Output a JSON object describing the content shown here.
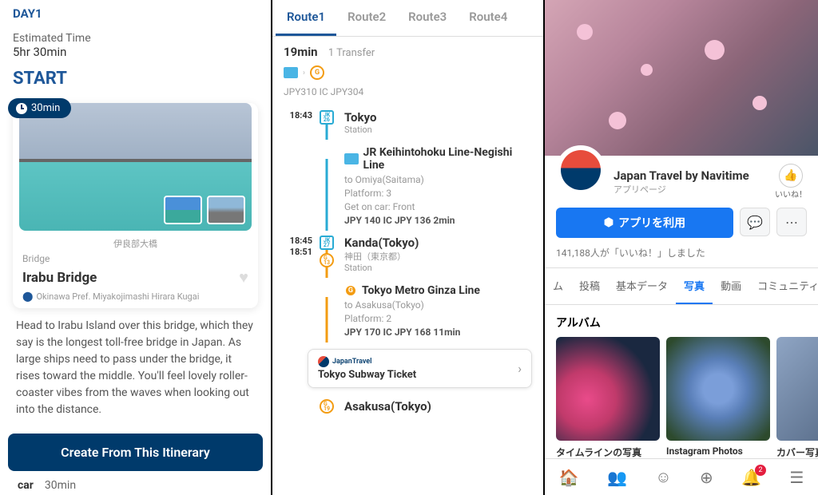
{
  "panel1": {
    "day": "DAY1",
    "estimatedLabel": "Estimated Time",
    "estimatedTime": "5hr 30min",
    "start": "START",
    "badge": "30min",
    "imageCaption": "伊良部大橋",
    "category": "Bridge",
    "poiName": "Irabu Bridge",
    "location": "Okinawa Pref. Miyakojimashi Hirara Kugai",
    "description": "Head to Irabu Island over this bridge, which they say is the longest toll-free bridge in Japan. As large ships need to pass under the bridge, it rises toward the middle. You'll feel lovely roller-coaster vibes from the waves when looking out into the distance.",
    "cta": "Create From This Itinerary",
    "nextMode": "car",
    "nextDuration": "30min"
  },
  "panel2": {
    "tabs": [
      "Route1",
      "Route2",
      "Route3",
      "Route4"
    ],
    "activeTab": 0,
    "duration": "19min",
    "transfers": "1 Transfer",
    "fare": "JPY310 IC JPY304",
    "steps": [
      {
        "time": "18:43",
        "marker": "JK\n26",
        "markerClass": "m-jk",
        "lineClass": "vl-blue",
        "name": "Tokyo",
        "sub": "Station"
      },
      {
        "time": "",
        "marker": "",
        "lineClass": "vl-blue",
        "lineName": "JR Keihintohoku Line-Negishi Line",
        "to": "to Omiya(Saitama)",
        "platform": "Platform: 3",
        "car": "Get on car: Front",
        "segFare": "JPY 140 IC JPY 136 2min",
        "lineIconClass": "ico-bus"
      },
      {
        "time": "18:45\n18:51",
        "marker": "JK\n27",
        "markerClass": "m-jk",
        "marker2": "G\n13",
        "marker2Class": "m-g",
        "lineClass": "vl-orange",
        "name": "Kanda(Tokyo)",
        "sub": "神田（東京都）",
        "sub2": "Station"
      },
      {
        "time": "",
        "marker": "",
        "lineClass": "vl-orange",
        "lineName": "Tokyo Metro Ginza Line",
        "to": "to Asakusa(Tokyo)",
        "platform": "Platform: 2",
        "segFare": "JPY 170 IC JPY 168 11min",
        "lineIconClass": "m-gf"
      },
      {
        "ticket": true,
        "logo": "JapanTravel",
        "title": "Tokyo Subway Ticket"
      },
      {
        "time": "",
        "marker": "G\n19",
        "markerClass": "m-g",
        "name": "Asakusa(Tokyo)"
      }
    ]
  },
  "panel3": {
    "pageTitle": "Japan Travel by Navitime",
    "pageSub": "アプリページ",
    "likeLabel": "いいね！",
    "useApp": "アプリを利用",
    "likesText": "141,188人が「いいね！」しました",
    "tabs": [
      "ム",
      "投稿",
      "基本データ",
      "写真",
      "動画",
      "コミュニティ"
    ],
    "activeTab": 3,
    "albumTitle": "アルバム",
    "albums": [
      {
        "cap": "タイムラインの写真",
        "cls": "a1"
      },
      {
        "cap": "Instagram Photos",
        "cls": "a2"
      },
      {
        "cap": "カバー写真",
        "cls": "a3"
      }
    ],
    "notifCount": "2"
  }
}
